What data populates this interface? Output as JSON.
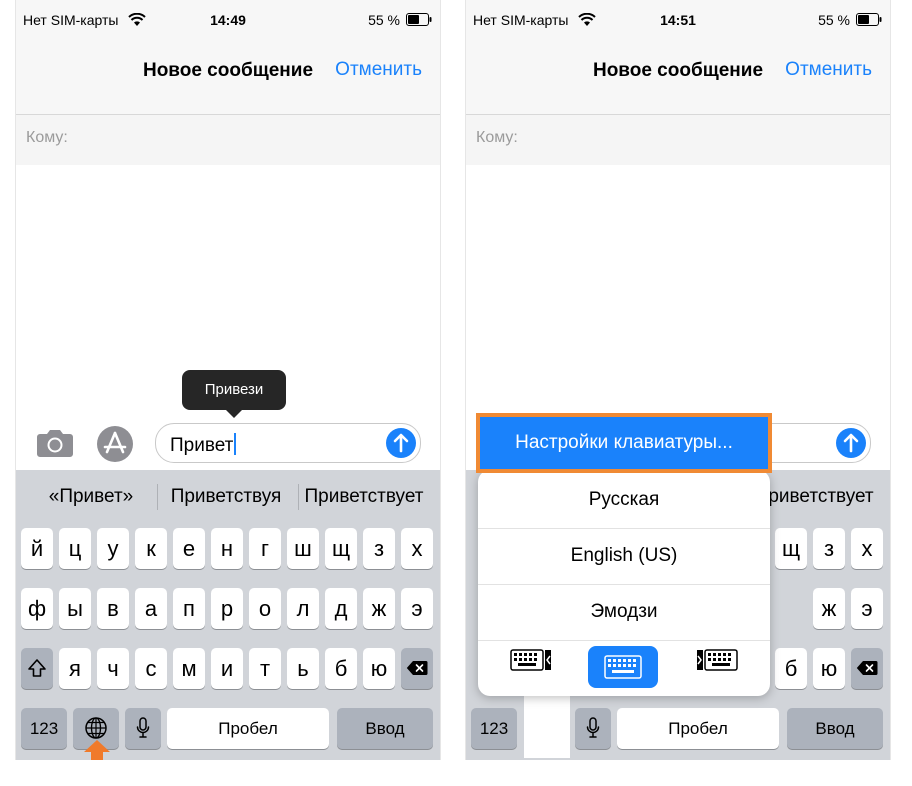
{
  "phone1": {
    "status": {
      "carrier": "Нет SIM-карты",
      "time": "14:49",
      "battery": "55 %"
    },
    "nav": {
      "title": "Новое сообщение",
      "cancel": "Отменить"
    },
    "to_label": "Кому:",
    "tooltip": "Привези",
    "input_value": "Привет",
    "suggestions": [
      "«Привет»",
      "Приветствуя",
      "Приветствует"
    ],
    "rows": [
      [
        "й",
        "ц",
        "у",
        "к",
        "е",
        "н",
        "г",
        "ш",
        "щ",
        "з",
        "х"
      ],
      [
        "ф",
        "ы",
        "в",
        "а",
        "п",
        "р",
        "о",
        "л",
        "д",
        "ж",
        "э"
      ],
      [
        "я",
        "ч",
        "с",
        "м",
        "и",
        "т",
        "ь",
        "б",
        "ю"
      ]
    ],
    "keys": {
      "numbers": "123",
      "space": "Пробел",
      "return": "Ввод"
    }
  },
  "phone2": {
    "status": {
      "carrier": "Нет SIM-карты",
      "time": "14:51",
      "battery": "55 %"
    },
    "nav": {
      "title": "Новое сообщение",
      "cancel": "Отменить"
    },
    "to_label": "Кому:",
    "suggestion_visible": "риветствует",
    "menu": {
      "settings": "Настройки клавиатуры...",
      "languages": [
        "Русская",
        "English (US)",
        "Эмодзи"
      ]
    },
    "row1_visible": [
      "щ",
      "з",
      "х"
    ],
    "row2_visible": [
      "ж",
      "э"
    ],
    "row3_visible": [
      "б",
      "ю"
    ],
    "keys": {
      "numbers": "123",
      "space": "Пробел",
      "return": "Ввод"
    }
  },
  "colors": {
    "accent": "#1a82fb",
    "highlight_border": "#f08a34",
    "keyboard_bg": "#d1d4d9"
  },
  "icons": [
    "wifi-icon",
    "battery-icon",
    "camera-icon",
    "appstore-icon",
    "send-arrow-icon",
    "shift-icon",
    "backspace-icon",
    "globe-icon",
    "microphone-icon",
    "keyboard-left-icon",
    "keyboard-full-icon",
    "keyboard-right-icon",
    "orange-arrow-icon"
  ]
}
